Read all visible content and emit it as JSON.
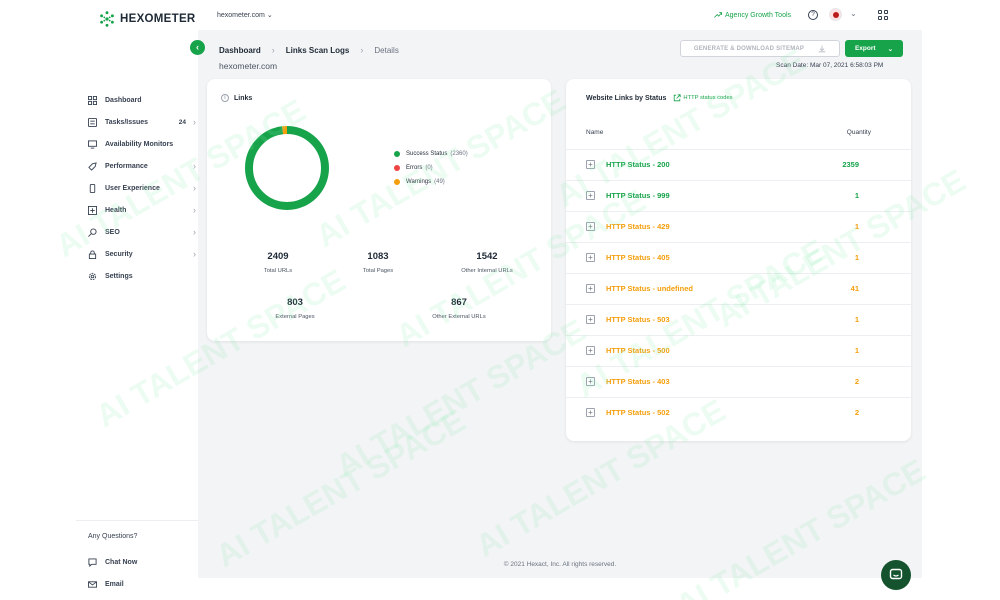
{
  "app": {
    "name": "HEXOMETER"
  },
  "header": {
    "domain_select": "hexometer.com",
    "agency_link": "Agency Growth Tools"
  },
  "sidebar": {
    "items": [
      {
        "label": "Dashboard",
        "icon": "dashboard-icon"
      },
      {
        "label": "Tasks/Issues",
        "badge": "24",
        "icon": "tasks-icon"
      },
      {
        "label": "Availability Monitors",
        "icon": "monitor-icon"
      },
      {
        "label": "Performance",
        "icon": "rocket-icon"
      },
      {
        "label": "User Experience",
        "icon": "mobile-icon"
      },
      {
        "label": "Health",
        "icon": "health-icon"
      },
      {
        "label": "SEO",
        "icon": "search-icon"
      },
      {
        "label": "Security",
        "icon": "lock-icon"
      },
      {
        "label": "Settings",
        "icon": "gear-icon"
      }
    ],
    "footer": {
      "title": "Any Questions?",
      "chat": "Chat Now",
      "email": "Email"
    }
  },
  "breadcrumb": [
    "Dashboard",
    "Links Scan Logs",
    "Details"
  ],
  "page": {
    "domain": "hexometer.com",
    "scan_date": "Scan Date:  Mar 07, 2021 6:58:03 PM",
    "generate_btn": "GENERATE & DOWNLOAD SITEMAP",
    "export_btn": "Export"
  },
  "links_card": {
    "title": "Links",
    "legend": [
      {
        "label": "Success Status",
        "count": "(2360)",
        "color": "#16a34a"
      },
      {
        "label": "Errors",
        "count": "(0)",
        "color": "#ef4444"
      },
      {
        "label": "Warnings",
        "count": "(49)",
        "color": "#f59e0b"
      }
    ],
    "donut": {
      "success": 2360,
      "errors": 0,
      "warnings": 49
    },
    "stats": {
      "total_urls": {
        "value": "2409",
        "label": "Total URLs"
      },
      "total_pages": {
        "value": "1083",
        "label": "Total Pages"
      },
      "other_internal": {
        "value": "1542",
        "label": "Other Internal URLs"
      },
      "external_pages": {
        "value": "803",
        "label": "External Pages"
      },
      "other_external": {
        "value": "867",
        "label": "Other External URLs"
      }
    }
  },
  "status_card": {
    "title": "Website Links by Status",
    "link": "HTTP status codes",
    "col_name": "Name",
    "col_quantity": "Quantity",
    "rows": [
      {
        "name": "HTTP Status - 200",
        "qty": "2359",
        "color": "#16a34a"
      },
      {
        "name": "HTTP Status - 999",
        "qty": "1",
        "color": "#16a34a"
      },
      {
        "name": "HTTP Status - 429",
        "qty": "1",
        "color": "#f59e0b"
      },
      {
        "name": "HTTP Status - 405",
        "qty": "1",
        "color": "#f59e0b"
      },
      {
        "name": "HTTP Status - undefined",
        "qty": "41",
        "color": "#f59e0b"
      },
      {
        "name": "HTTP Status - 503",
        "qty": "1",
        "color": "#f59e0b"
      },
      {
        "name": "HTTP Status - 500",
        "qty": "1",
        "color": "#f59e0b"
      },
      {
        "name": "HTTP Status - 403",
        "qty": "2",
        "color": "#f59e0b"
      },
      {
        "name": "HTTP Status - 502",
        "qty": "2",
        "color": "#f59e0b"
      }
    ]
  },
  "footer": {
    "copyright": "© 2021 Hexact, Inc. All rights reserved."
  },
  "watermark": "AI TALENT SPACE"
}
